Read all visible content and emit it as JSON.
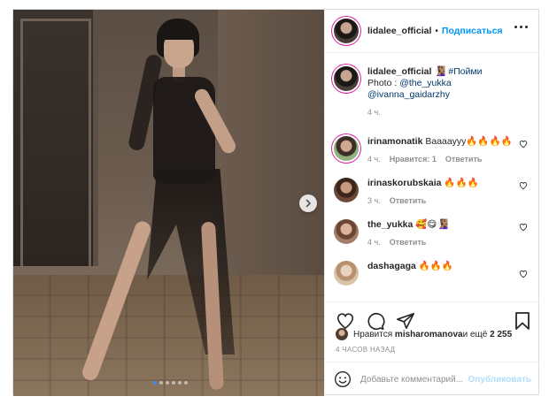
{
  "post": {
    "author": "lidalee_official",
    "follow_label": "Подписаться",
    "separator": "•"
  },
  "caption": {
    "username": "lidalee_official",
    "emoji": "🧏🏽‍♀️",
    "hashtag": "#Пойми",
    "line2_prefix": "Photo : ",
    "mention1": "@the_yukka",
    "mention2": "@ivanna_gaidarzhy",
    "time": "4 ч."
  },
  "comments": [
    {
      "username": "irinamonatik",
      "text": "Вааааууу🔥🔥🔥🔥",
      "time": "4 ч.",
      "likes": "Нравится: 1",
      "reply": "Ответить"
    },
    {
      "username": "irinaskorubskaia",
      "text": "🔥🔥🔥",
      "time": "3 ч.",
      "likes": "",
      "reply": "Ответить"
    },
    {
      "username": "the_yukka",
      "text": "🥰😋🧏🏽‍♀️",
      "time": "4 ч.",
      "likes": "",
      "reply": "Ответить"
    },
    {
      "username": "dashagaga",
      "text": "🔥🔥🔥",
      "time": "",
      "likes": "",
      "reply": ""
    }
  ],
  "likes": {
    "prefix": "Нравится ",
    "user": "misharomanova",
    "middle": " и ещё ",
    "count": "2 255"
  },
  "timestamp": "4 ЧАСОВ НАЗАД",
  "add_comment": {
    "placeholder": "Добавьте комментарий...",
    "publish_label": "Опубликовать"
  },
  "carousel": {
    "total": 6,
    "active": 1
  },
  "colors": {
    "link": "#0095f6",
    "mention": "#00376b",
    "text": "#262626",
    "muted": "#8e8e8e",
    "publish_disabled": "#b2dffc",
    "story_ring": "#d6249f"
  },
  "icons": [
    "heart-icon",
    "comment-icon",
    "share-icon",
    "bookmark-icon",
    "emoji-icon",
    "more-icon",
    "chevron-right-icon"
  ]
}
